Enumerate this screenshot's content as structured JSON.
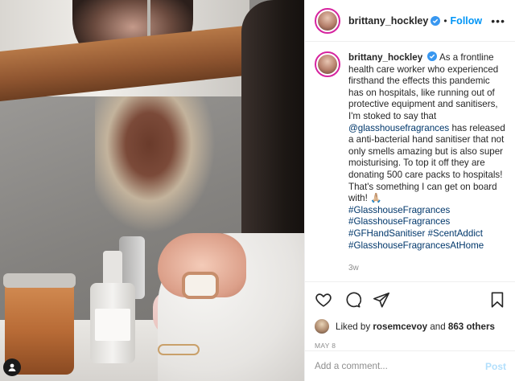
{
  "header": {
    "username": "brittany_hockley",
    "separator": "•",
    "follow_label": "Follow",
    "more_label": "•••"
  },
  "caption": {
    "username": "brittany_hockley",
    "text_1": "As a frontline health care worker who experienced firsthand the effects this pandemic has on hospitals, like running out of protective equipment and sanitisers, I'm stoked to say that",
    "mention": "@glasshousefragrances",
    "text_2": "has released a anti-bacterial hand sanitiser that not only smells amazing but is also super moisturising. To top it off they are donating 500 care packs to hospitals! That's something I can get on board with! 🙏🏼",
    "hashtags": [
      "#GlasshouseFragrances",
      "#GlasshouseFragrances",
      "#GFHandSanitiser",
      "#ScentAddict",
      "#GlasshouseFragrancesAtHome"
    ],
    "time_ago": "3w"
  },
  "likes": {
    "prefix": "Liked by",
    "user": "rosemcevoy",
    "conjunction": "and",
    "others": "863 others"
  },
  "date": "MAY 8",
  "comment": {
    "placeholder": "Add a comment...",
    "post_label": "Post"
  },
  "icons": {
    "like": "heart-icon",
    "comment": "comment-icon",
    "share": "share-icon",
    "save": "bookmark-icon",
    "verified": "verified-badge-icon",
    "tagged": "user-tag-icon"
  },
  "colors": {
    "link": "#00376b",
    "follow": "#0095f6",
    "verified": "#3897f0",
    "post_disabled": "#b2dffc",
    "secondary_text": "#8e8e8e"
  }
}
